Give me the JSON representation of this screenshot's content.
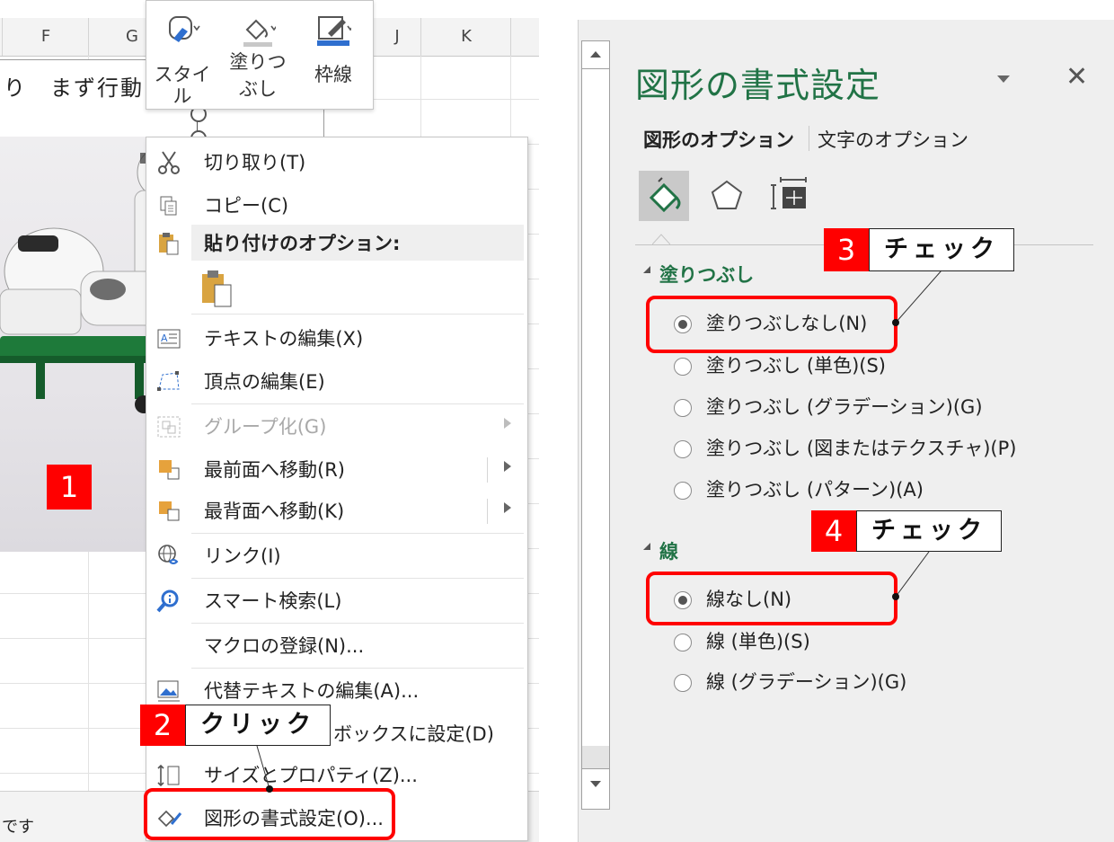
{
  "sheet": {
    "columns": [
      "F",
      "G",
      "J",
      "K"
    ],
    "cell_text": "り　まず行動",
    "status_text": "です"
  },
  "mini_toolbar": {
    "buttons": [
      {
        "label": "スタイル",
        "icon": "shape-style-icon"
      },
      {
        "label_line1": "塗りつ",
        "label_line2": "ぶし",
        "icon": "fill-bucket-icon"
      },
      {
        "label": "枠線",
        "icon": "pen-outline-icon"
      }
    ]
  },
  "context_menu": {
    "items": [
      {
        "label": "切り取り(T)",
        "icon": "scissors-icon"
      },
      {
        "label": "コピー(C)",
        "icon": "copy-icon"
      },
      {
        "label": "貼り付けのオプション:",
        "icon": "paste-icon"
      },
      {
        "label": "テキストの編集(X)",
        "icon": "edit-text-icon"
      },
      {
        "label": "頂点の編集(E)",
        "icon": "edit-points-icon"
      },
      {
        "label": "グループ化(G)",
        "icon": "group-icon"
      },
      {
        "label": "最前面へ移動(R)",
        "icon": "bring-to-front-icon"
      },
      {
        "label": "最背面へ移動(K)",
        "icon": "send-to-back-icon"
      },
      {
        "label": "リンク(I)",
        "icon": "link-icon"
      },
      {
        "label": "スマート検索(L)",
        "icon": "smart-lookup-icon"
      },
      {
        "label": "マクロの登録(N)...",
        "icon": ""
      },
      {
        "label": "代替テキストの編集(A)...",
        "icon": "alt-text-icon"
      },
      {
        "label": "ボックスに設定(D)",
        "icon": ""
      },
      {
        "label": "サイズとプロパティ(Z)...",
        "icon": "size-properties-icon"
      },
      {
        "label": "図形の書式設定(O)...",
        "icon": "format-shape-icon"
      }
    ]
  },
  "pane": {
    "title": "図形の書式設定",
    "tab_shape": "図形のオプション",
    "tab_text": "文字のオプション",
    "fill_section": "塗りつぶし",
    "fill_options": [
      "塗りつぶしなし(N)",
      "塗りつぶし (単色)(S)",
      "塗りつぶし (グラデーション)(G)",
      "塗りつぶし (図またはテクスチャ)(P)",
      "塗りつぶし (パターン)(A)"
    ],
    "line_section": "線",
    "line_options": [
      "線なし(N)",
      "線 (単色)(S)",
      "線 (グラデーション)(G)"
    ],
    "accent_color": "#217346"
  },
  "annotations": {
    "step1": "1",
    "step2_num": "2",
    "step2_text": "クリック",
    "step3_num": "3",
    "step3_text": "チェック",
    "step4_num": "4",
    "step4_text": "チェック",
    "highlight_color": "#ff0000"
  }
}
